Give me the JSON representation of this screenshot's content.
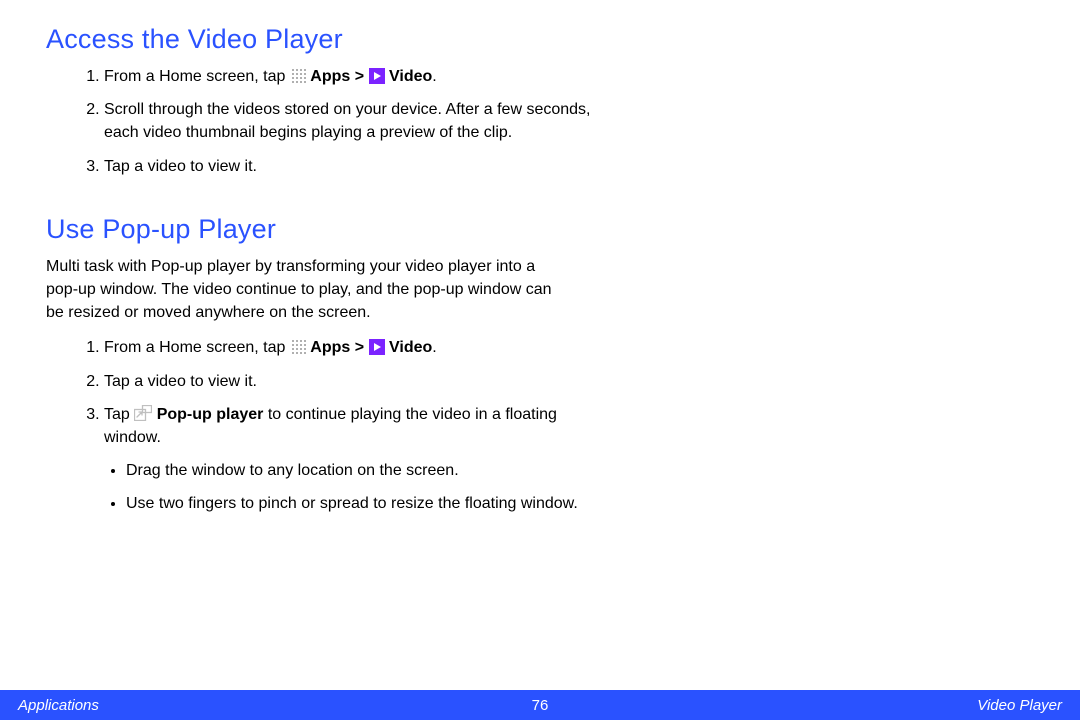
{
  "section1": {
    "heading": "Access the Video Player",
    "steps": {
      "s1_pre": "From a Home screen, tap ",
      "s1_apps": " Apps > ",
      "s1_video": " Video",
      "s1_post": ".",
      "s2": "Scroll through the videos stored on your device. After a few seconds, each video thumbnail begins playing a preview of the clip.",
      "s3": "Tap a video to view it."
    }
  },
  "section2": {
    "heading": "Use Pop-up Player",
    "lead": "Multi task with Pop-up player by transforming your video player into a pop-up window. The video continue to play, and the pop-up window can be resized or moved anywhere on the screen.",
    "steps": {
      "s1_pre": "From a Home screen, tap ",
      "s1_apps": " Apps > ",
      "s1_video": " Video",
      "s1_post": ".",
      "s2": "Tap a video to view it.",
      "s3_pre": "Tap ",
      "s3_popup": " Pop-up player",
      "s3_post": " to continue playing the video in a floating window.",
      "sub1": "Drag the window to any location on the screen.",
      "sub2": "Use two fingers to pinch or spread to resize the floating window."
    }
  },
  "footer": {
    "left": "Applications",
    "page": "76",
    "right": "Video Player"
  }
}
